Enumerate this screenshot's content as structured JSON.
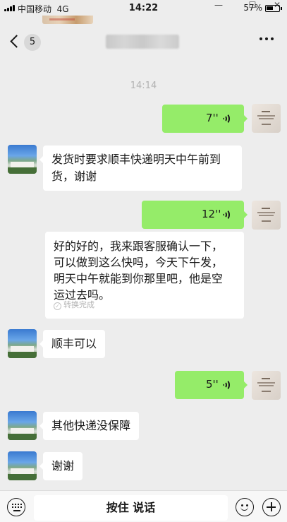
{
  "status_bar": {
    "carrier": "中国移动",
    "network": "4G",
    "time": "14:22",
    "battery_percent": "57%",
    "battery_level": 0.57,
    "window_controls": [
      "—",
      "☐",
      "✕"
    ]
  },
  "nav": {
    "unread_count": "5",
    "more_icon": "ellipsis-icon"
  },
  "timestamp": "14:14",
  "messages": [
    {
      "from": "self",
      "type": "voice",
      "duration": "7''"
    },
    {
      "from": "other",
      "type": "text",
      "lines": [
        "发货时要求顺丰快递明天中午前到",
        "货，谢谢"
      ]
    },
    {
      "from": "self",
      "type": "voice",
      "duration": "12''"
    },
    {
      "from": "system",
      "type": "transcript",
      "lines": [
        "好的好的，我来跟客服确认一下，",
        "可以做到这么快吗，今天下午发，",
        "明天中午就能到你那里吧，他是空",
        "运过去吗。"
      ],
      "status": "转换完成"
    },
    {
      "from": "other",
      "type": "text",
      "lines": [
        "顺丰可以"
      ]
    },
    {
      "from": "self",
      "type": "voice",
      "duration": "5''"
    },
    {
      "from": "other",
      "type": "text",
      "lines": [
        "其他快递没保障"
      ]
    },
    {
      "from": "other",
      "type": "text",
      "lines": [
        "谢谢"
      ]
    }
  ],
  "input_bar": {
    "hold_to_talk": "按住 说话",
    "keyboard_icon": "keyboard-icon",
    "emoji_icon": "emoji-icon",
    "plus_icon": "plus-icon"
  },
  "colors": {
    "background": "#ededed",
    "self_bubble": "#95ec69",
    "other_bubble": "#ffffff"
  }
}
